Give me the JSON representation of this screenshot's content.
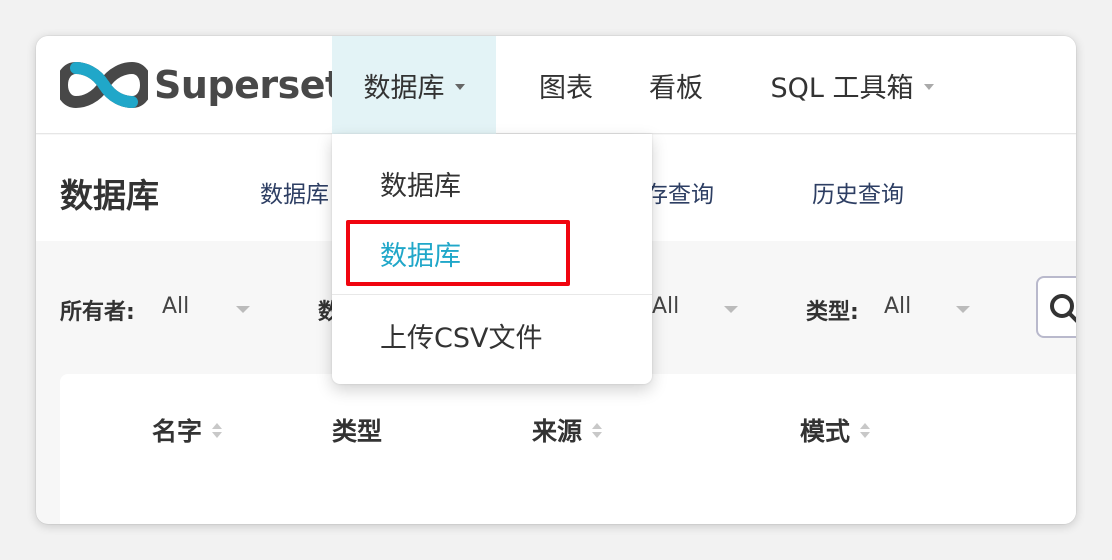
{
  "brand": {
    "name": "Superset",
    "logo_color_dark": "#484848",
    "logo_color_accent": "#20a7c9"
  },
  "nav": {
    "items": [
      {
        "label": "数据库",
        "has_caret": true,
        "active": true
      },
      {
        "label": "图表",
        "has_caret": false
      },
      {
        "label": "看板",
        "has_caret": false
      },
      {
        "label": "SQL 工具箱",
        "has_caret": true
      }
    ]
  },
  "subheader": {
    "title": "数据库",
    "links": [
      "数据库",
      "保存查询",
      "历史查询"
    ]
  },
  "dropdown": {
    "items": [
      "数据库",
      "数据库",
      "上传CSV文件"
    ],
    "highlighted_index": 1
  },
  "filters": [
    {
      "label": "所有者:",
      "value": "All"
    },
    {
      "label": "数据库:",
      "value": "All"
    },
    {
      "label": "类型:",
      "value": "All"
    }
  ],
  "table": {
    "columns": [
      "名字",
      "类型",
      "来源",
      "模式"
    ]
  },
  "colors": {
    "active_nav_bg": "#e3f3f6",
    "highlight_text": "#20a7c9",
    "annotation_border": "#f0050f"
  },
  "icons": {
    "search": "search-icon",
    "sort": "sort-icon",
    "caret": "chevron-down-icon"
  }
}
